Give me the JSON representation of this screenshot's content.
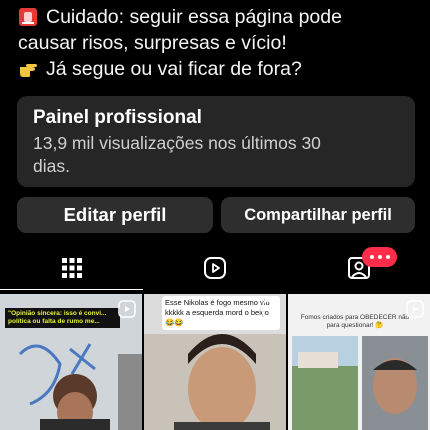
{
  "bio": {
    "line1": "Cuidado: seguir essa página pode",
    "line2": "causar risos, surpresas e vício!",
    "line3": "Já segue ou vai ficar de fora?"
  },
  "dashboard": {
    "title": "Painel profissional",
    "stats_line1": "13,9 mil visualizações nos últimos 30",
    "stats_line2": "dias."
  },
  "actions": {
    "edit_label": "Editar perfil",
    "share_label": "Compartilhar perfil"
  },
  "tabs": {
    "items": [
      "grid-icon",
      "reels-icon",
      "tagged-icon"
    ],
    "active": "grid-icon",
    "badge_color": "#ff2d4a"
  },
  "posts": [
    {
      "caption": "\"Opinião sincera: isso é convi... política ou falta de rumo me..."
    },
    {
      "caption": "Esse Nikolas é fogo mesmo viu kkkkk a esquerda mord o beiço 😂😂"
    },
    {
      "caption": "Fomos criados para OBEDECER não para questionar! 🤔"
    }
  ],
  "colors": {
    "background": "#000000",
    "surface": "#262626",
    "button": "#2e2e2e",
    "text": "#f5f5f5"
  }
}
